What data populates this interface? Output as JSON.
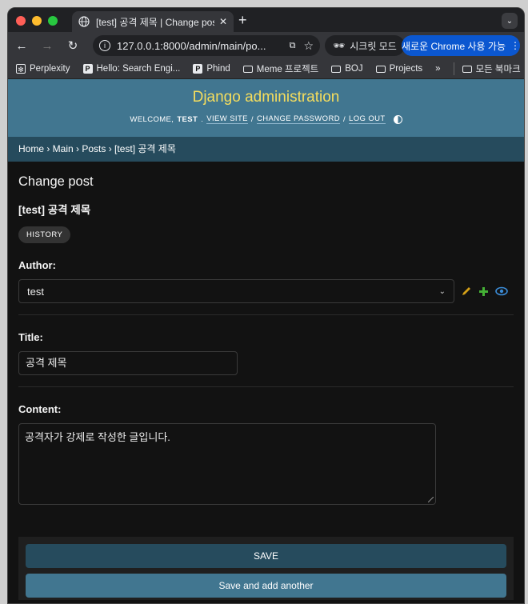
{
  "browser": {
    "tab_title": "[test] 공격 제목 | Change post |",
    "url": "127.0.0.1:8000/admin/main/po...",
    "incognito_label": "시크릿 모드",
    "update_label": "새로운 Chrome 사용 가능",
    "bookmarks": [
      "Perplexity",
      "Hello: Search Engi...",
      "Phind",
      "Meme 프로젝트",
      "BOJ",
      "Projects"
    ],
    "bookmarks_more": "»",
    "all_bookmarks": "모든 북마크"
  },
  "header": {
    "branding": "Django administration",
    "welcome": "WELCOME,",
    "username": "TEST",
    "view_site": "VIEW SITE",
    "change_password": "CHANGE PASSWORD",
    "log_out": "LOG OUT"
  },
  "breadcrumbs": "Home › Main › Posts › [test] 공격 제목",
  "page": {
    "title": "Change post",
    "object_title": "[test] 공격 제목",
    "history": "HISTORY"
  },
  "form": {
    "author_label": "Author:",
    "author_value": "test",
    "title_label": "Title:",
    "title_value": "공격 제목",
    "content_label": "Content:",
    "content_value": "공격자가 강제로 작성한 글입니다."
  },
  "buttons": {
    "save": "SAVE",
    "save_add_another": "Save and add another"
  },
  "colors": {
    "header_bg": "#417690",
    "branding": "#f5dd5d",
    "breadcrumbs_bg": "#264b5d"
  }
}
